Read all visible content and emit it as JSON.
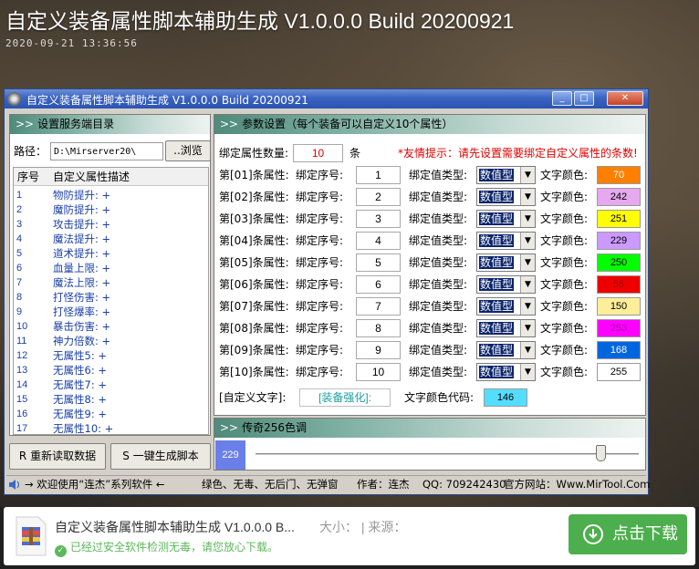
{
  "page": {
    "title": "自定义装备属性脚本辅助生成 V1.0.0.0 Build 20200921",
    "date": "2020-09-21 13:36:56"
  },
  "window": {
    "title": "自定义装备属性脚本辅助生成 V1.0.0.0 Build 20200921",
    "minimize": "_",
    "maximize": "□",
    "close": "✕"
  },
  "left": {
    "header": "设置服务端目录",
    "path_label": "路径：",
    "path_value": "D:\\Mirserver20\\",
    "browse_label": "..浏览",
    "col_num": "序号",
    "col_desc": "自定义属性描述",
    "rows": [
      {
        "num": "1",
        "desc": "物防提升: +"
      },
      {
        "num": "2",
        "desc": "魔防提升: +"
      },
      {
        "num": "3",
        "desc": "攻击提升: +"
      },
      {
        "num": "4",
        "desc": "魔法提升: +"
      },
      {
        "num": "5",
        "desc": "道术提升: +"
      },
      {
        "num": "6",
        "desc": "血量上限: +"
      },
      {
        "num": "7",
        "desc": "魔法上限: +"
      },
      {
        "num": "8",
        "desc": "打怪伤害: +"
      },
      {
        "num": "9",
        "desc": "打怪爆率: +"
      },
      {
        "num": "10",
        "desc": "暴击伤害: +"
      },
      {
        "num": "11",
        "desc": "神力倍数: +"
      },
      {
        "num": "12",
        "desc": "无属性5: +"
      },
      {
        "num": "13",
        "desc": "无属性6: +"
      },
      {
        "num": "14",
        "desc": "无属性7: +"
      },
      {
        "num": "15",
        "desc": "无属性8: +"
      },
      {
        "num": "16",
        "desc": "无属性9: +"
      },
      {
        "num": "17",
        "desc": "无属性10: +"
      }
    ],
    "reload_button": "R 重新读取数据",
    "generate_button": "S 一键生成脚本"
  },
  "params": {
    "header": "参数设置（每个装备可以自定义10个属性）",
    "count_label": "绑定属性数量:",
    "count_value": "10",
    "count_unit": "条",
    "hint": "*友情提示：请先设置需要绑定自定义属性的条数!",
    "bind_label": "绑定序号:",
    "type_label": "绑定值类型:",
    "color_label": "文字颜色:",
    "rows": [
      {
        "label": "第[01]条属性:",
        "index": "1",
        "type": "数值型",
        "color_value": "70",
        "color": "#ff7f00",
        "text_color": "#ffffff"
      },
      {
        "label": "第[02]条属性:",
        "index": "2",
        "type": "数值型",
        "color_value": "242",
        "color": "#e6a8ee",
        "text_color": "#000000"
      },
      {
        "label": "第[03]条属性:",
        "index": "3",
        "type": "数值型",
        "color_value": "251",
        "color": "#ffff00",
        "text_color": "#000000"
      },
      {
        "label": "第[04]条属性:",
        "index": "4",
        "type": "数值型",
        "color_value": "229",
        "color": "#cc99ff",
        "text_color": "#000000"
      },
      {
        "label": "第[05]条属性:",
        "index": "5",
        "type": "数值型",
        "color_value": "250",
        "color": "#00ff00",
        "text_color": "#000000"
      },
      {
        "label": "第[06]条属性:",
        "index": "6",
        "type": "数值型",
        "color_value": "56",
        "color": "#ee0000",
        "text_color": "#aa0000"
      },
      {
        "label": "第[07]条属性:",
        "index": "7",
        "type": "数值型",
        "color_value": "150",
        "color": "#ffee99",
        "text_color": "#000000"
      },
      {
        "label": "第[08]条属性:",
        "index": "8",
        "type": "数值型",
        "color_value": "253",
        "color": "#ff00ff",
        "text_color": "#aa00aa"
      },
      {
        "label": "第[09]条属性:",
        "index": "9",
        "type": "数值型",
        "color_value": "168",
        "color": "#0066dd",
        "text_color": "#ffffff"
      },
      {
        "label": "第[10]条属性:",
        "index": "10",
        "type": "数值型",
        "color_value": "255",
        "color": "#ffffff",
        "text_color": "#000000"
      }
    ],
    "custom_label": "[自定义文字]:",
    "custom_value": "[装备强化]:",
    "color_code_label": "文字颜色代码:",
    "color_code_value": "146",
    "color_code_bg": "#55ddff"
  },
  "slider": {
    "header": "传奇256色调",
    "value": "229",
    "value_bg": "#6a7fe8",
    "level": 0.9
  },
  "status": {
    "welcome": "→ 欢迎使用“连杰”系列软件 ←",
    "features": "绿色、无毒、无后门、无弹窗",
    "author": "作者：连杰",
    "qq": "QQ: 709242430",
    "site": "官方网站：Www.MirTool.Com"
  },
  "download": {
    "title": "自定义装备属性脚本辅助生成 V1.0.0.0 B...",
    "meta": "大小：  | 来源：",
    "safe": "已经过安全软件检测无毒，请您放心下载。",
    "button": "点击下载",
    "accent": "#4cae4c"
  }
}
